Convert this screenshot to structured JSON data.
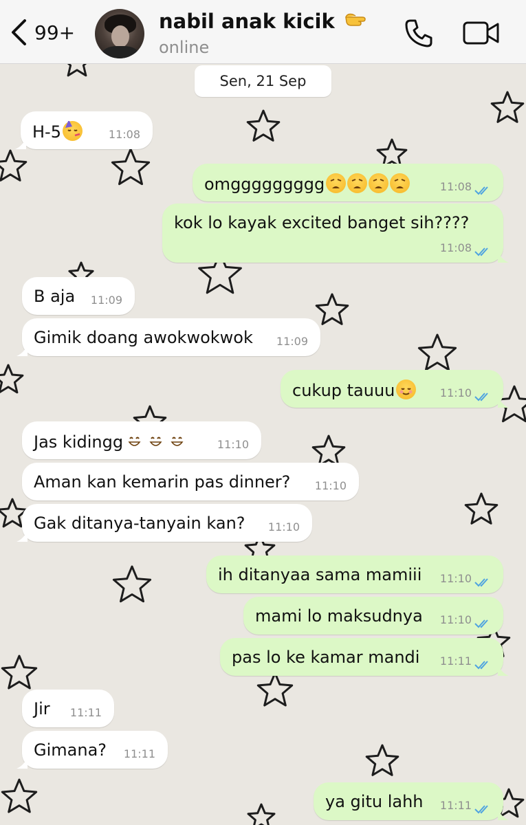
{
  "header": {
    "unread_count": "99+",
    "contact_name": "nabil anak kicik",
    "contact_status": "online"
  },
  "date_label": "Sen, 21 Sep",
  "colors": {
    "incoming_bubble": "#ffffff",
    "outgoing_bubble": "#dcf8c6",
    "read_ticks": "#4fa3e0",
    "background": "#eae7e1"
  },
  "messages": [
    {
      "dir": "in",
      "text": "H-5",
      "emoji": [
        "party-face"
      ],
      "time": "11:08"
    },
    {
      "dir": "out",
      "text": "omggggggggg",
      "emoji": [
        "weary-face",
        "weary-face",
        "weary-face",
        "weary-face"
      ],
      "time": "11:08",
      "status": "read"
    },
    {
      "dir": "out",
      "text": "kok lo kayak excited banget sih????",
      "time": "11:08",
      "status": "read"
    },
    {
      "dir": "in",
      "text": "B aja",
      "time": "11:09"
    },
    {
      "dir": "in",
      "text": "Gimik doang awokwokwok",
      "time": "11:09"
    },
    {
      "dir": "out",
      "text": "cukup tauuu",
      "emoji": [
        "relieved-face"
      ],
      "time": "11:10",
      "status": "read"
    },
    {
      "dir": "in",
      "text": "Jas kidingg",
      "emoji": [
        "grinning-face",
        "grinning-face",
        "grinning-face"
      ],
      "time": "11:10"
    },
    {
      "dir": "in",
      "text": "Aman kan kemarin pas dinner?",
      "time": "11:10"
    },
    {
      "dir": "in",
      "text": "Gak ditanya-tanyain kan?",
      "time": "11:10"
    },
    {
      "dir": "out",
      "text": "ih ditanyaa sama mamiii",
      "time": "11:10",
      "status": "read"
    },
    {
      "dir": "out",
      "text": "mami lo maksudnya",
      "time": "11:10",
      "status": "read"
    },
    {
      "dir": "out",
      "text": "pas lo ke kamar mandi",
      "time": "11:11",
      "status": "read"
    },
    {
      "dir": "in",
      "text": "Jir",
      "time": "11:11"
    },
    {
      "dir": "in",
      "text": "Gimana?",
      "time": "11:11"
    },
    {
      "dir": "out",
      "text": "ya gitu lahh",
      "time": "11:11",
      "status": "read"
    }
  ]
}
